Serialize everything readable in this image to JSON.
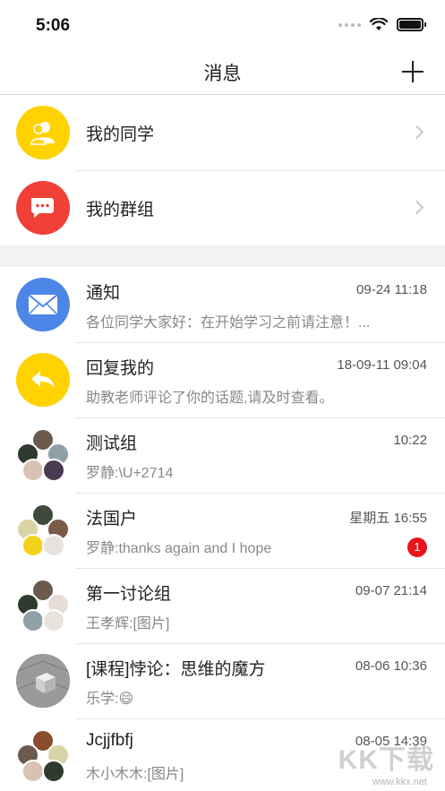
{
  "status_bar": {
    "time": "5:06"
  },
  "nav": {
    "title": "消息",
    "add_icon": "plus-icon"
  },
  "entries": [
    {
      "label": "我的同学",
      "icon": "classmates-icon",
      "color": "#ffd200"
    },
    {
      "label": "我的群组",
      "icon": "chat-bubbles-icon",
      "color": "#f04037"
    }
  ],
  "messages": [
    {
      "title": "通知",
      "time": "09-24  11:18",
      "preview": "各位同学大家好：在开始学习之前请注意！...",
      "avatar": "mail-icon",
      "color": "#4d86e6"
    },
    {
      "title": "回复我的",
      "time": "18-09-11  09:04",
      "preview": "助教老师评论了你的话题,请及时查看。",
      "avatar": "reply-icon",
      "color": "#ffd200"
    },
    {
      "title": "测试组",
      "time": "10:22",
      "preview": "罗静:\\U+2714",
      "avatar": "group-avatar"
    },
    {
      "title": "法国户",
      "time": "星期五 16:55",
      "preview": "罗静:thanks again and I hope",
      "avatar": "group-avatar",
      "badge": "1"
    },
    {
      "title": "第一讨论组",
      "time": "09-07  21:14",
      "preview": "王孝辉:[图片]",
      "avatar": "group-avatar"
    },
    {
      "title": "[课程]悖论：思维的魔方",
      "time": "08-06  10:36",
      "preview": "乐学:😄",
      "avatar": "course-cube-icon"
    },
    {
      "title": "Jcjjfbfj",
      "time": "08-05  14:39",
      "preview": "木小木木:[图片]",
      "avatar": "group-avatar"
    }
  ],
  "watermark": {
    "big": "KK下载",
    "small": "www.kkx.net"
  }
}
